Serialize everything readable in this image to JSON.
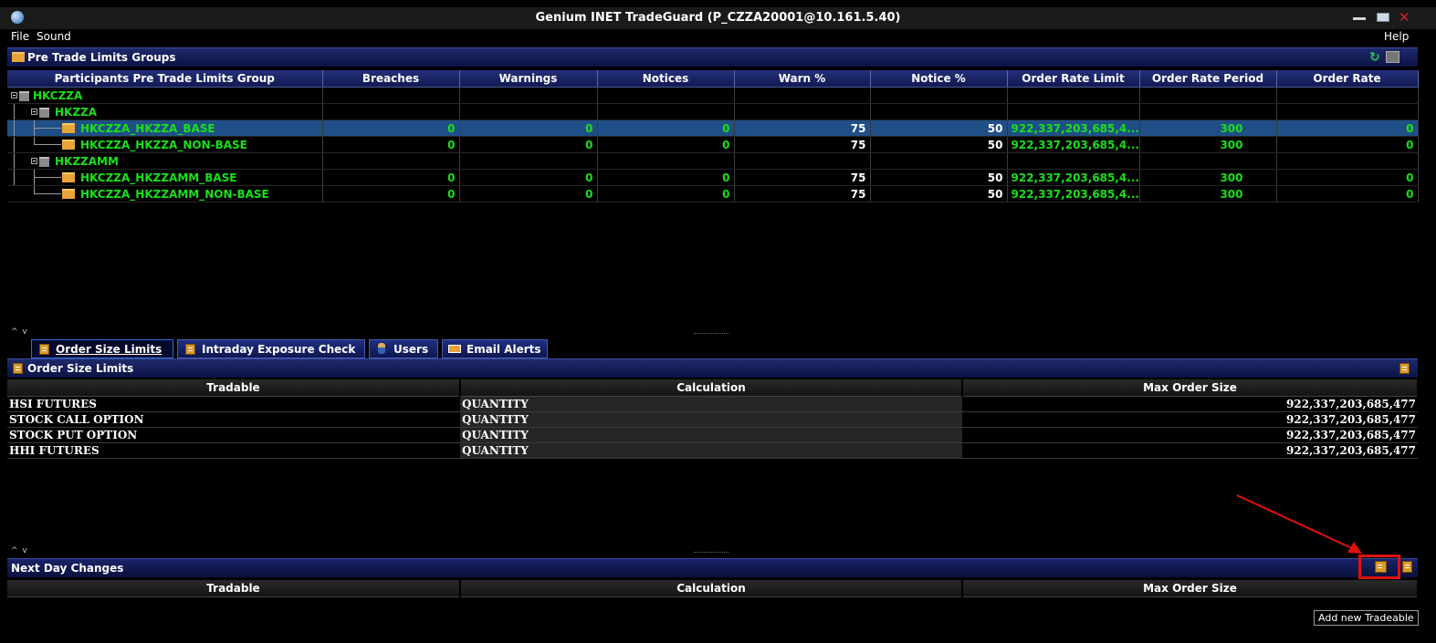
{
  "window": {
    "title": "Genium INET TradeGuard (P_CZZA20001@10.161.5.40)"
  },
  "menu": {
    "file": "File",
    "sound": "Sound",
    "help": "Help"
  },
  "groups_panel": {
    "title": "Pre Trade Limits Groups",
    "columns": [
      "Participants Pre Trade Limits Group",
      "Breaches",
      "Warnings",
      "Notices",
      "Warn %",
      "Notice %",
      "Order Rate Limit",
      "Order Rate Period",
      "Order Rate"
    ],
    "rows": [
      {
        "level": 0,
        "name": "HKCZZA",
        "type": "group"
      },
      {
        "level": 1,
        "name": "HKZZA",
        "type": "group"
      },
      {
        "level": 2,
        "name": "HKCZZA_HKZZA_BASE",
        "type": "item",
        "selected": true,
        "breaches": "0",
        "warnings": "0",
        "notices": "0",
        "warn_pct": "75",
        "notice_pct": "50",
        "order_rate_limit": "922,337,203,685,4...",
        "order_rate_period": "300",
        "order_rate": "0"
      },
      {
        "level": 2,
        "name": "HKCZZA_HKZZA_NON-BASE",
        "type": "item",
        "breaches": "0",
        "warnings": "0",
        "notices": "0",
        "warn_pct": "75",
        "notice_pct": "50",
        "order_rate_limit": "922,337,203,685,4...",
        "order_rate_period": "300",
        "order_rate": "0"
      },
      {
        "level": 1,
        "name": "HKZZAMM",
        "type": "group"
      },
      {
        "level": 2,
        "name": "HKCZZA_HKZZAMM_BASE",
        "type": "item",
        "breaches": "0",
        "warnings": "0",
        "notices": "0",
        "warn_pct": "75",
        "notice_pct": "50",
        "order_rate_limit": "922,337,203,685,4...",
        "order_rate_period": "300",
        "order_rate": "0"
      },
      {
        "level": 2,
        "name": "HKCZZA_HKZZAMM_NON-BASE",
        "type": "item",
        "breaches": "0",
        "warnings": "0",
        "notices": "0",
        "warn_pct": "75",
        "notice_pct": "50",
        "order_rate_limit": "922,337,203,685,4...",
        "order_rate_period": "300",
        "order_rate": "0"
      }
    ]
  },
  "tabs": [
    {
      "label": "Order Size Limits",
      "active": true
    },
    {
      "label": "Intraday Exposure Check"
    },
    {
      "label": "Users"
    },
    {
      "label": "Email Alerts"
    }
  ],
  "order_size_panel": {
    "title": "Order Size Limits",
    "columns": [
      "Tradable",
      "Calculation",
      "Max Order Size"
    ],
    "rows": [
      {
        "tradable": "HSI FUTURES",
        "calculation": "QUANTITY",
        "max_order_size": "922,337,203,685,477"
      },
      {
        "tradable": "STOCK CALL OPTION",
        "calculation": "QUANTITY",
        "max_order_size": "922,337,203,685,477"
      },
      {
        "tradable": "STOCK PUT OPTION",
        "calculation": "QUANTITY",
        "max_order_size": "922,337,203,685,477"
      },
      {
        "tradable": "HHI FUTURES",
        "calculation": "QUANTITY",
        "max_order_size": "922,337,203,685,477"
      }
    ]
  },
  "next_day_panel": {
    "title": "Next Day Changes",
    "columns": [
      "Tradable",
      "Calculation",
      "Max Order Size"
    ],
    "tooltip": "Add new Tradeable"
  },
  "colors": {
    "accent_green": "#18e018",
    "selection": "#1f4f86",
    "header_blue": "#121a52",
    "highlight_red": "#e01010"
  }
}
